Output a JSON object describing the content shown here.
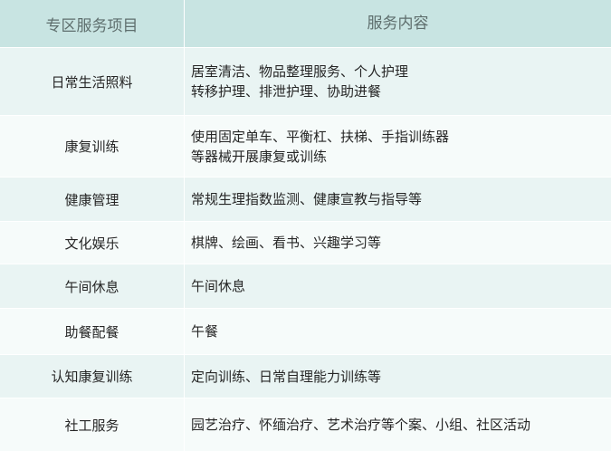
{
  "header": {
    "col1": "专区服务项目",
    "col2": "服务内容"
  },
  "rows": [
    {
      "item": "日常生活照料",
      "lines": [
        "居室清洁、物品整理服务、个人护理",
        "转移护理、排泄护理、协助进餐"
      ]
    },
    {
      "item": "康复训练",
      "lines": [
        "使用固定单车、平衡杠、扶梯、手指训练器",
        "等器械开展康复或训练"
      ]
    },
    {
      "item": "健康管理",
      "lines": [
        "常规生理指数监测、健康宣教与指导等"
      ]
    },
    {
      "item": "文化娱乐",
      "lines": [
        "棋牌、绘画、看书、兴趣学习等"
      ]
    },
    {
      "item": "午间休息",
      "lines": [
        "午间休息"
      ]
    },
    {
      "item": "助餐配餐",
      "lines": [
        "午餐"
      ]
    },
    {
      "item": "认知康复训练",
      "lines": [
        "定向训练、日常自理能力训练等"
      ]
    },
    {
      "item": "社工服务",
      "lines": [
        "园艺治疗、怀缅治疗、艺术治疗等个案、小组、社区活动"
      ]
    }
  ],
  "colors": {
    "header_bg": "#c8e4e2",
    "row_odd": "#e9f4f3",
    "row_even": "#f6fbfa"
  }
}
